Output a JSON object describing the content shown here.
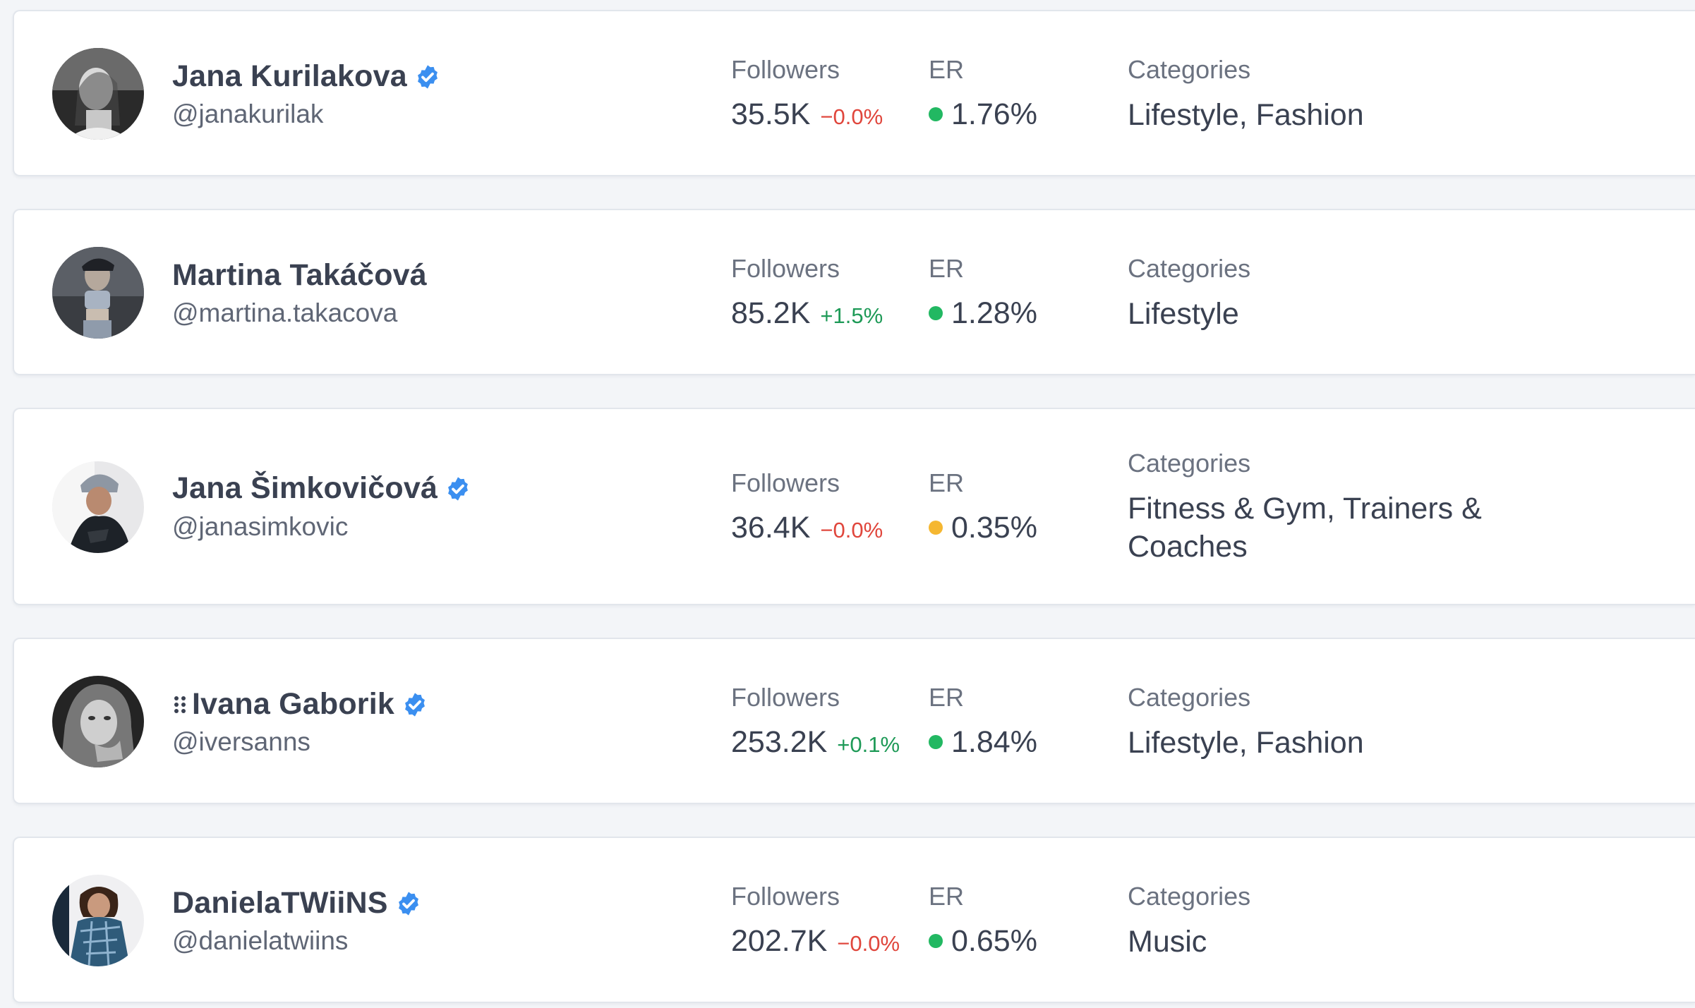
{
  "labels": {
    "followers": "Followers",
    "er": "ER",
    "categories": "Categories"
  },
  "colors": {
    "er_good": "#22b862",
    "er_warn": "#f5b731",
    "delta_negative": "#e0463c",
    "delta_positive": "#1e9a57",
    "verified_badge": "#3b8ff0"
  },
  "influencers": [
    {
      "name": "Jana Kurilakova",
      "handle": "@janakurilak",
      "verified": true,
      "followers": "35.5K",
      "followers_change": "−0.0%",
      "er": "1.76%",
      "er_status": "good",
      "categories": "Lifestyle, Fashion"
    },
    {
      "name": "Martina Takáčová",
      "handle": "@martina.takacova",
      "verified": false,
      "followers": "85.2K",
      "followers_change": "+1.5%",
      "er": "1.28%",
      "er_status": "good",
      "categories": "Lifestyle"
    },
    {
      "name": "Jana Šimkovičová",
      "handle": "@janasimkovic",
      "verified": true,
      "followers": "36.4K",
      "followers_change": "−0.0%",
      "er": "0.35%",
      "er_status": "warn",
      "categories": "Fitness & Gym, Trainers & Coaches"
    },
    {
      "name": "Ivana Gaborik",
      "handle": "@iversanns",
      "verified": true,
      "followers": "253.2K",
      "followers_change": "+0.1%",
      "er": "1.84%",
      "er_status": "good",
      "categories": "Lifestyle, Fashion"
    },
    {
      "name": "DanielaTWiiNS",
      "handle": "@danielatwiins",
      "verified": true,
      "followers": "202.7K",
      "followers_change": "−0.0%",
      "er": "0.65%",
      "er_status": "good",
      "categories": "Music"
    }
  ]
}
